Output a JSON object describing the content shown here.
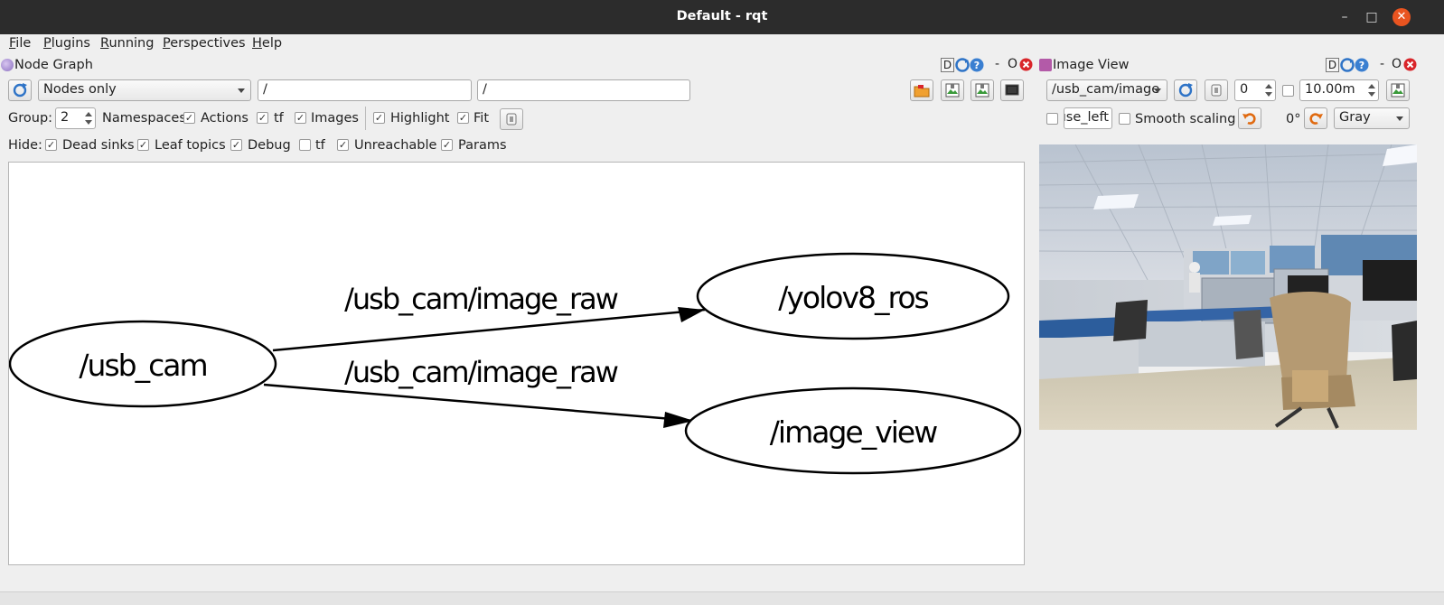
{
  "window": {
    "title": "Default - rqt"
  },
  "menu": [
    {
      "label": "File",
      "key": "F",
      "rest": "ile"
    },
    {
      "label": "Plugins",
      "key": "P",
      "rest": "lugins"
    },
    {
      "label": "Running",
      "key": "R",
      "rest": "unning"
    },
    {
      "label": "Perspectives",
      "key": "P",
      "rest": "erspectives"
    },
    {
      "label": "Help",
      "key": "H",
      "rest": "elp"
    }
  ],
  "node_graph": {
    "title": "Node Graph",
    "dock_buttons": [
      "D",
      "-",
      "O"
    ],
    "display_mode": "Nodes only",
    "filter_ns": "/",
    "filter_topics": "/",
    "group_label": "Group:",
    "group_value": "2",
    "options": [
      {
        "label": "Namespaces",
        "checked": false
      },
      {
        "label": "Actions",
        "checked": true
      },
      {
        "label": "tf",
        "checked": true
      },
      {
        "label": "Images",
        "checked": true
      },
      {
        "label": "Highlight",
        "checked": true
      },
      {
        "label": "Fit",
        "checked": true
      }
    ],
    "hide_label": "Hide:",
    "hide_options": [
      {
        "label": "Dead sinks",
        "checked": true
      },
      {
        "label": "Leaf topics",
        "checked": true
      },
      {
        "label": "Debug",
        "checked": true
      },
      {
        "label": "tf",
        "checked": false
      },
      {
        "label": "Unreachable",
        "checked": true
      },
      {
        "label": "Params",
        "checked": true
      }
    ],
    "nodes": {
      "usb_cam": "/usb_cam",
      "yolov8_ros": "/yolov8_ros",
      "image_view": "/image_view"
    },
    "edges": [
      {
        "from": "/usb_cam",
        "to": "/yolov8_ros",
        "label": "/usb_cam/image_raw"
      },
      {
        "from": "/usb_cam",
        "to": "/image_view",
        "label": "/usb_cam/image_raw"
      }
    ]
  },
  "image_view": {
    "title": "Image View",
    "dock_buttons": [
      "D",
      "-",
      "O"
    ],
    "topic": "/usb_cam/image",
    "value": "0",
    "max_range": "10.00m",
    "max_range_checked": false,
    "mouse_topic": "use_left",
    "mouse_checked": false,
    "smooth_label": "Smooth scaling",
    "smooth_checked": false,
    "rotation": "0°",
    "color_scheme": "Gray"
  },
  "colors": {
    "titlebar": "#2c2c2c",
    "close": "#e95420",
    "refresh_icon": "#2f74c7"
  }
}
